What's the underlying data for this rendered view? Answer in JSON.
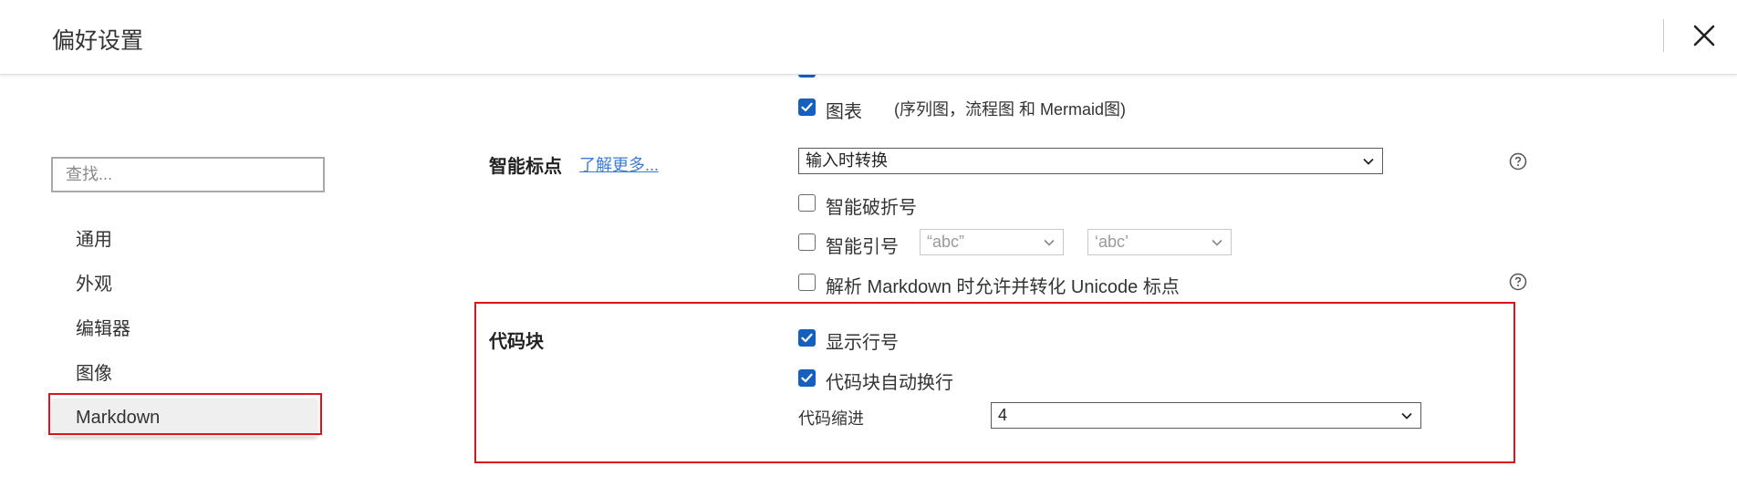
{
  "header": {
    "title": "偏好设置",
    "close_icon": "close-icon"
  },
  "sidebar": {
    "search": {
      "value": "",
      "placeholder": "查找..."
    },
    "items": [
      {
        "label": "通用"
      },
      {
        "label": "外观"
      },
      {
        "label": "编辑器"
      },
      {
        "label": "图像"
      },
      {
        "label": "Markdown",
        "active": true
      }
    ]
  },
  "content": {
    "diagrams": {
      "label": "图表",
      "note": "(序列图，流程图 和 Mermaid图)",
      "checked": true
    },
    "smart_punct": {
      "title": "智能标点",
      "learn_more": "了解更多...",
      "mode": "输入时转换",
      "smart_dash": {
        "label": "智能破折号",
        "checked": false
      },
      "smart_quotes": {
        "label": "智能引号",
        "checked": false,
        "double_value": "“abc”",
        "single_value": "‘abc’"
      },
      "unicode": {
        "label": "解析 Markdown 时允许并转化 Unicode 标点",
        "checked": false
      }
    },
    "code_block": {
      "title": "代码块",
      "line_numbers": {
        "label": "显示行号",
        "checked": true
      },
      "word_wrap": {
        "label": "代码块自动换行",
        "checked": true
      },
      "indent": {
        "label": "代码缩进",
        "value": "4"
      }
    }
  },
  "colors": {
    "accent": "#1560bd",
    "highlight_border": "#d9151b",
    "link": "#3b7dd8"
  }
}
